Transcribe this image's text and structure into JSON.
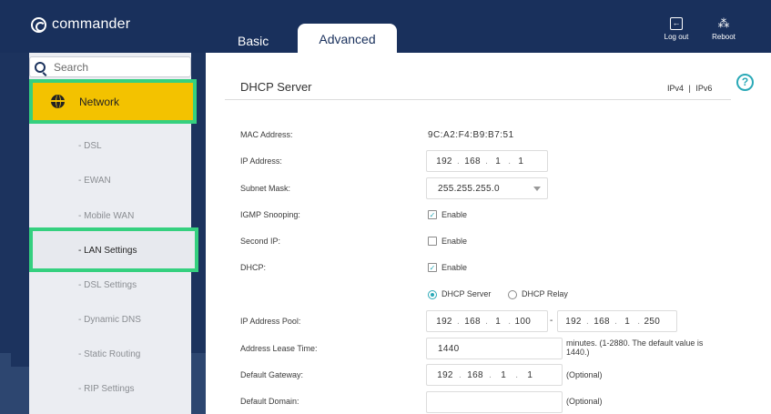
{
  "brand": "commander",
  "tabs": {
    "basic": "Basic",
    "advanced": "Advanced"
  },
  "header": {
    "logout": "Log out",
    "reboot": "Reboot"
  },
  "search": {
    "placeholder": "Search"
  },
  "nav": {
    "network": "Network",
    "items": [
      "- DSL",
      "- EWAN",
      "- Mobile WAN",
      "- LAN Settings",
      "- DSL Settings",
      "- Dynamic DNS",
      "- Static Routing",
      "- RIP Settings"
    ]
  },
  "section": {
    "title": "DHCP Server",
    "ipv4": "IPv4",
    "sep": "|",
    "ipv6": "IPv6",
    "help": "?"
  },
  "form": {
    "mac_label": "MAC Address:",
    "mac_value": "9C:A2:F4:B9:B7:51",
    "ip_label": "IP Address:",
    "ip": [
      "192",
      "168",
      "1",
      "1"
    ],
    "subnet_label": "Subnet Mask:",
    "subnet_value": "255.255.255.0",
    "igmp_label": "IGMP Snooping:",
    "igmp_enable": "Enable",
    "igmp_checked": true,
    "second_ip_label": "Second IP:",
    "second_ip_enable": "Enable",
    "second_ip_checked": false,
    "dhcp_label": "DHCP:",
    "dhcp_enable": "Enable",
    "dhcp_checked": true,
    "dhcp_server": "DHCP Server",
    "dhcp_relay": "DHCP Relay",
    "dhcp_mode_selected": "DHCP Server",
    "pool_label": "IP Address Pool:",
    "pool_start": [
      "192",
      "168",
      "1",
      "100"
    ],
    "pool_end": [
      "192",
      "168",
      "1",
      "250"
    ],
    "pool_dash": "-",
    "lease_label": "Address Lease Time:",
    "lease_value": "1440",
    "lease_hint": "minutes. (1-2880. The default value is 1440.)",
    "gateway_label": "Default Gateway:",
    "gateway": [
      "192",
      "168",
      "1",
      "1"
    ],
    "gateway_hint": "(Optional)",
    "domain_label": "Default Domain:",
    "domain_value": "",
    "domain_hint": "(Optional)"
  },
  "colors": {
    "header_bg": "#19305c",
    "nav_active": "#f3c200",
    "highlight_border": "#35d07f",
    "accent": "#2aa9b7"
  }
}
